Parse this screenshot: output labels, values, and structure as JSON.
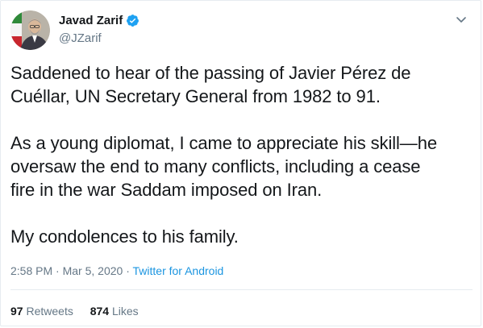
{
  "author": {
    "display_name": "Javad Zarif",
    "handle": "@JZarif",
    "verified_icon": "verified-badge-icon",
    "avatar_icon": "avatar-photo"
  },
  "menu": {
    "icon": "chevron-down-icon"
  },
  "tweet": {
    "lines": [
      [
        "Saddened to hear of the passing of Javier Pérez de",
        "Cuéllar, UN Secretary General from 1982 to 91."
      ],
      [
        "As a young diplomat, I came to appreciate his skill—he",
        "oversaw the end to many conflicts, including a cease",
        "fire in the war Saddam imposed on Iran."
      ],
      [
        "My condolences to his family."
      ]
    ]
  },
  "meta": {
    "time": "2:58 PM",
    "sep1": "·",
    "date": "Mar 5, 2020",
    "sep2": "·",
    "source": "Twitter for Android"
  },
  "stats": {
    "retweets_count": "97",
    "retweets_label": "Retweets",
    "likes_count": "874",
    "likes_label": "Likes"
  },
  "colors": {
    "text": "#14171a",
    "muted": "#657786",
    "link": "#1b95e0",
    "verified": "#1da1f2",
    "border": "#e6ecf0"
  }
}
